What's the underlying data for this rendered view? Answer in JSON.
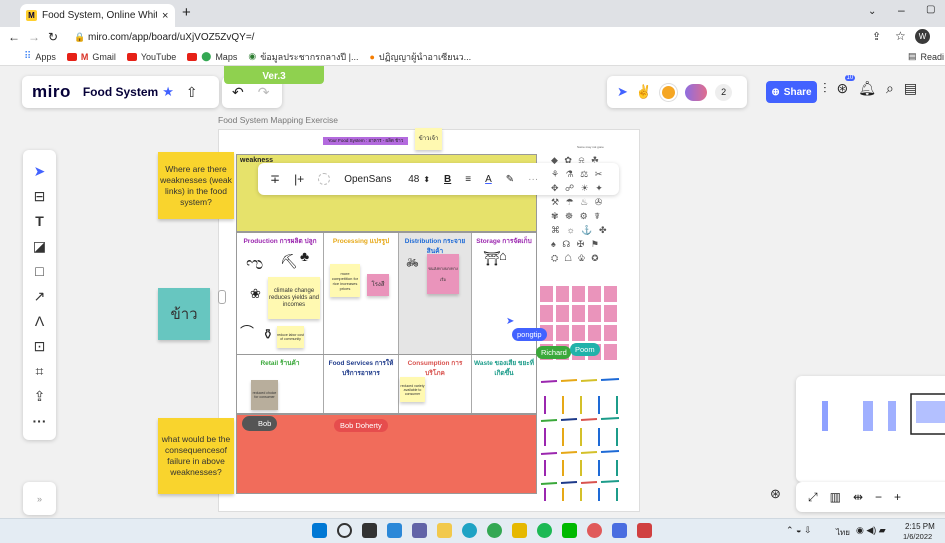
{
  "browser": {
    "tab_title": "Food System, Online Whiteboar",
    "url": "miro.com/app/board/uXjVOZ5ZvQY=/",
    "bookmarks": [
      "Apps",
      "Gmail",
      "YouTube",
      "Maps",
      "ข้อมูลประชากรกลางปี |...",
      "ปฏิญญาผู้นำอาเซียนว..."
    ],
    "reading_list": "Readi"
  },
  "miro": {
    "logo": "miro",
    "board_name": "Food System",
    "frame_tag": "Ver.3",
    "share_label": "Share",
    "avatar_count": "2",
    "avatar_initial": "W",
    "notification_badge": "10",
    "accent": "#4262ff"
  },
  "text_toolbar": {
    "font": "OpenSans",
    "size": "48"
  },
  "board": {
    "frame_title": "Food System Mapping Exercise",
    "header_note": "Your Food System : อาหาร - ผลิต ข้าว",
    "corner_note": "ข้าวเจ้า",
    "weakness_label": "weakness",
    "tiny_label": "Some may not gone",
    "columns_top": [
      {
        "label": "Production การผลิต ปลูก",
        "color": "#9b27af"
      },
      {
        "label": "Processing แปรรูป",
        "color": "#e6a817"
      },
      {
        "label": "Distribution กระจายสินค้า",
        "color": "#1e6ad6"
      },
      {
        "label": "Storage การจัดเก็บ",
        "color": "#9b27af"
      }
    ],
    "columns_bottom": [
      {
        "label": "Retail ร้านค้า",
        "color": "#3aa83a"
      },
      {
        "label": "Food Services การให้บริการอาหาร",
        "color": "#1e3a8a"
      },
      {
        "label": "Consumption การบริโภค",
        "color": "#d9534f"
      },
      {
        "label": "Waste ของเสีย ขยะที่เกิดขึ้น",
        "color": "#1c9c8a"
      }
    ],
    "notes": {
      "climate": "climate change reduces yields and incomes",
      "more_comp": "more competition for rice increases prices",
      "rice_mill": "โรงสี",
      "distribution_note": "ขนส่งทางบก/ทางเรือ",
      "small_note": "reduce labor cost of community",
      "retail_note": "reduced choice for consumer",
      "consumption_note": "reduced variety available to consumer"
    },
    "sticky_left_top": "Where are there weaknesses (weak links) in the food system?",
    "sticky_left_bottom": "what would be the consequencesof failure in above weaknesses?",
    "sticky_rice": "ข้าว",
    "cursor_names": [
      "pongtip",
      "Richard",
      "Poom",
      "Bob",
      "Bob Doherty"
    ]
  },
  "taskbar": {
    "time": "2:15 PM",
    "date": "1/6/2022",
    "lang": "ไทย"
  }
}
